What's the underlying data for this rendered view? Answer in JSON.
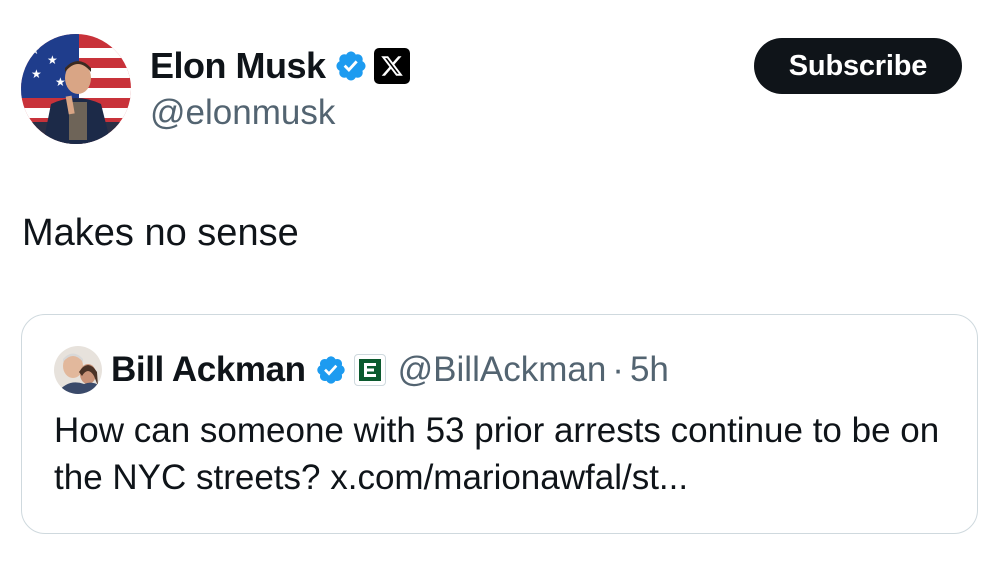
{
  "author": {
    "display_name": "Elon Musk",
    "handle": "@elonmusk",
    "verified_icon": "verified-badge-icon",
    "affiliation_icon": "x-logo-icon"
  },
  "subscribe_label": "Subscribe",
  "tweet": {
    "text": "Makes no sense"
  },
  "quoted_tweet": {
    "display_name": "Bill Ackman",
    "handle": "@BillAckman",
    "separator": "·",
    "time": "5h",
    "text": "How can someone with 53 prior arrests continue to be on the NYC streets? x.com/marionawfal/st...",
    "affiliation_icon": "pershing-square-logo-icon"
  },
  "colors": {
    "text_primary": "#0f1419",
    "text_secondary": "#536471",
    "verified_blue": "#1d9bf0",
    "button_bg": "#0f1419",
    "border": "#cfd9de"
  }
}
